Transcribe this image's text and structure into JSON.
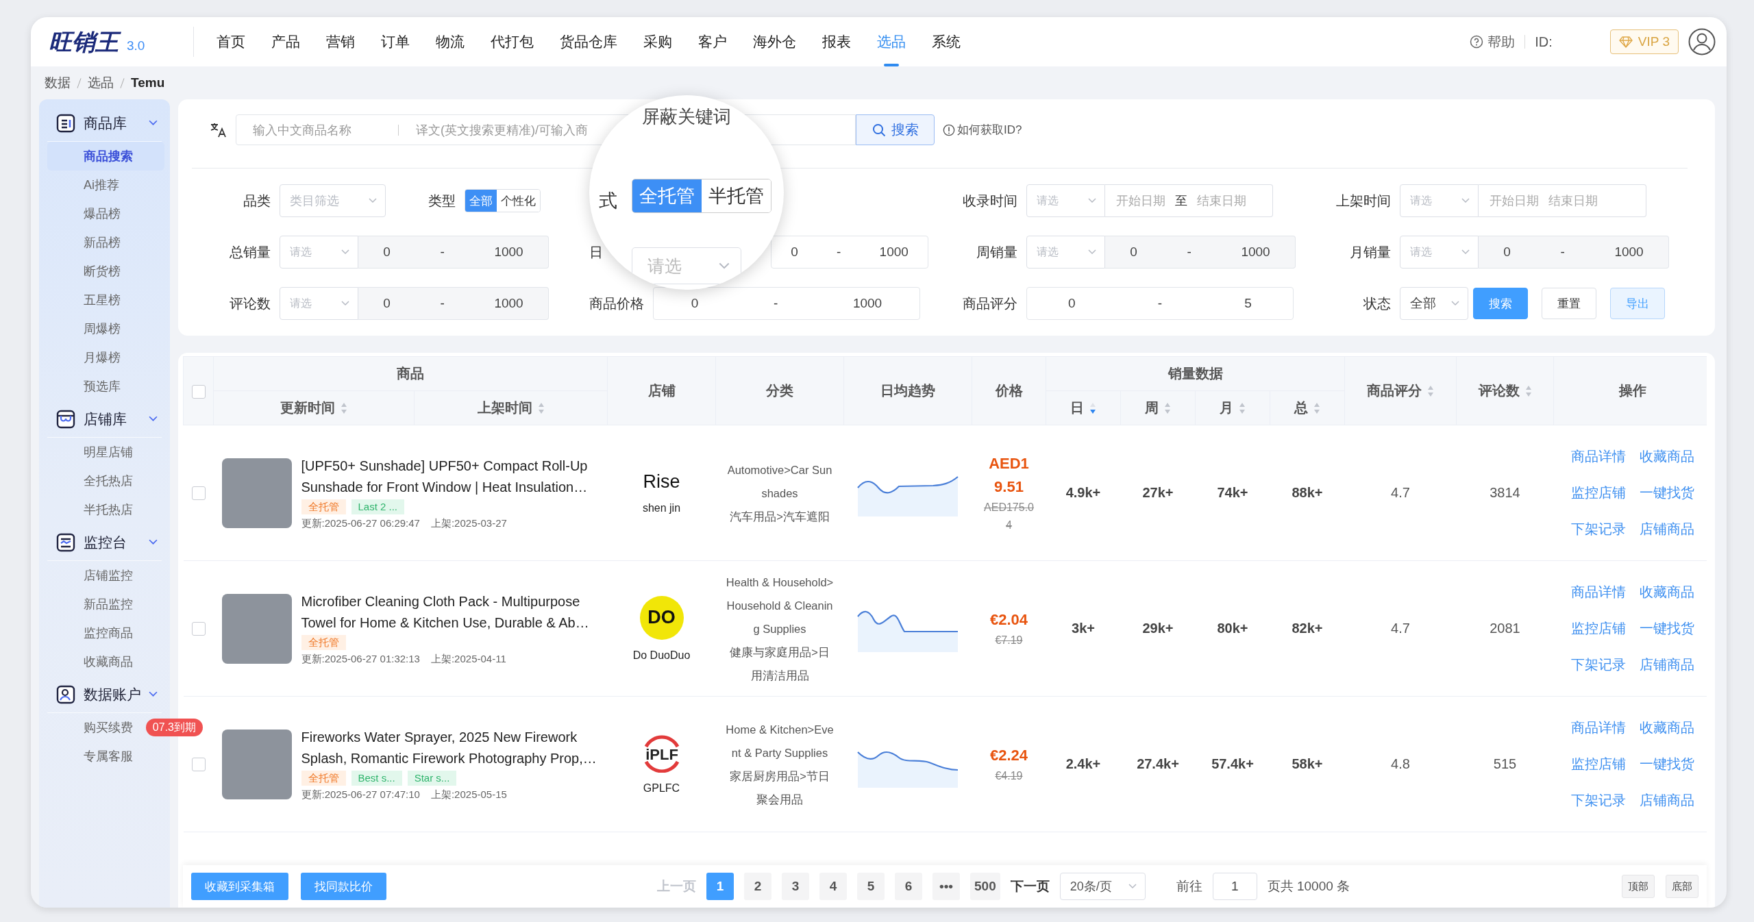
{
  "logo": {
    "name": "旺销王",
    "version": "3.0"
  },
  "nav": [
    {
      "label": "首页",
      "selected": false
    },
    {
      "label": "产品",
      "selected": false
    },
    {
      "label": "营销",
      "selected": false
    },
    {
      "label": "订单",
      "selected": false
    },
    {
      "label": "物流",
      "selected": false
    },
    {
      "label": "代打包",
      "selected": false
    },
    {
      "label": "货品仓库",
      "selected": false
    },
    {
      "label": "采购",
      "selected": false
    },
    {
      "label": "客户",
      "selected": false
    },
    {
      "label": "海外仓",
      "selected": false
    },
    {
      "label": "报表",
      "selected": false
    },
    {
      "label": "选品",
      "selected": true
    },
    {
      "label": "系统",
      "selected": false
    }
  ],
  "header_right": {
    "help": "帮助",
    "id_label": "ID:",
    "vip": "VIP 3"
  },
  "breadcrumb": [
    {
      "label": "数据",
      "current": false
    },
    {
      "label": "选品",
      "current": false
    },
    {
      "label": "Temu",
      "current": true
    }
  ],
  "sidebar": [
    {
      "title": "商品库",
      "expanded": true,
      "items": [
        {
          "label": "商品搜索",
          "selected": true
        },
        {
          "label": "Ai推荐",
          "selected": false
        },
        {
          "label": "爆品榜",
          "selected": false
        },
        {
          "label": "新品榜",
          "selected": false
        },
        {
          "label": "断货榜",
          "selected": false
        },
        {
          "label": "五星榜",
          "selected": false
        },
        {
          "label": "周爆榜",
          "selected": false
        },
        {
          "label": "月爆榜",
          "selected": false
        },
        {
          "label": "预选库",
          "selected": false
        }
      ]
    },
    {
      "title": "店铺库",
      "expanded": true,
      "items": [
        {
          "label": "明星店铺",
          "selected": false
        },
        {
          "label": "全托热店",
          "selected": false
        },
        {
          "label": "半托热店",
          "selected": false
        }
      ]
    },
    {
      "title": "监控台",
      "expanded": true,
      "items": [
        {
          "label": "店铺监控",
          "selected": false
        },
        {
          "label": "新品监控",
          "selected": false
        },
        {
          "label": "监控商品",
          "selected": false
        },
        {
          "label": "收藏商品",
          "selected": false
        }
      ]
    },
    {
      "title": "数据账户",
      "expanded": true,
      "items": [
        {
          "label": "购买续费",
          "selected": false,
          "badge": "07.3到期"
        },
        {
          "label": "专属客服",
          "selected": false
        }
      ]
    }
  ],
  "search": {
    "placeholder": "输入中文商品名称",
    "translation_placeholder": "译文(英文搜索更精准)/可输入商",
    "button": "搜索",
    "help_link": "如何获取ID?"
  },
  "filters": [
    [
      {
        "kind": "select",
        "label": "品类",
        "placeholder": "类目筛选"
      },
      {
        "kind": "toggle",
        "label": "类型",
        "options": [
          {
            "label": "全部",
            "selected": true
          },
          {
            "label": "个性化",
            "selected": false
          }
        ]
      },
      {
        "kind": "daterange",
        "label": "收录时间",
        "select": "请选",
        "start": "开始日期",
        "separator": "至",
        "end": "结束日期"
      },
      {
        "kind": "daterange",
        "label": "上架时间",
        "select": "请选",
        "start": "开始日期",
        "end": "结束日期"
      }
    ],
    [
      {
        "kind": "range",
        "label": "总销量",
        "select": "请选",
        "min": "0",
        "dash": "-",
        "max": "1000"
      },
      {
        "kind": "range",
        "label": "日",
        "min": "0",
        "dash": "-",
        "max": "1000"
      },
      {
        "kind": "range",
        "label": "周销量",
        "select": "请选",
        "min": "0",
        "dash": "-",
        "max": "1000"
      },
      {
        "kind": "range",
        "label": "月销量",
        "select": "请选",
        "min": "0",
        "dash": "-",
        "max": "1000"
      }
    ],
    [
      {
        "kind": "range",
        "label": "评论数",
        "select": "请选",
        "min": "0",
        "dash": "-",
        "max": "1000"
      },
      {
        "kind": "range",
        "label": "商品价格",
        "min": "0",
        "dash": "-",
        "max": "1000"
      },
      {
        "kind": "range",
        "label": "商品评分",
        "min": "0",
        "dash": "-",
        "max": "5"
      },
      {
        "kind": "status",
        "label": "状态",
        "value": "全部"
      },
      {
        "kind": "buttons",
        "buttons": [
          {
            "label": "搜索",
            "kind": "primary"
          },
          {
            "label": "重置",
            "kind": "default"
          },
          {
            "label": "导出",
            "kind": "light"
          }
        ]
      }
    ]
  ],
  "magnifier": {
    "caption": "屏蔽关键词",
    "label": "式",
    "options": [
      {
        "label": "全托管",
        "selected": true
      },
      {
        "label": "半托管",
        "selected": false
      }
    ],
    "select": "请选"
  },
  "table": {
    "select_all_checked": false,
    "product_group": "商品",
    "sales_group": "销量数据",
    "columns": [
      {
        "label": "更新时间",
        "sorted": false
      },
      {
        "label": "上架时间",
        "sorted": false
      },
      {
        "label": "店铺"
      },
      {
        "label": "分类"
      },
      {
        "label": "日均趋势"
      },
      {
        "label": "价格"
      },
      {
        "label": "日",
        "sorted": true
      },
      {
        "label": "周",
        "sorted": false
      },
      {
        "label": "月",
        "sorted": false
      },
      {
        "label": "总",
        "sorted": false
      },
      {
        "label": "商品评分",
        "sorted": false
      },
      {
        "label": "评论数",
        "sorted": false
      },
      {
        "label": "操作"
      }
    ],
    "rows": [
      {
        "checked": false,
        "title": "[UPF50+ Sunshade] UPF50+ Compact Roll-Up Sunshade for Front Window | Heat Insulation…",
        "tags": [
          {
            "label": "全托管",
            "kind": "mode"
          },
          {
            "label": "Last 2 ...",
            "kind": "tag"
          }
        ],
        "updated": "更新:2025-06-27 06:29:47",
        "listed": "上架:2025-03-27",
        "store": {
          "logo": "Rise",
          "kind": "wordmark",
          "name": "shen jin"
        },
        "category_en": "Automotive>Car Sunshades",
        "category_cn": "汽车用品>汽车遮阳",
        "trend": {
          "kind": "wave"
        },
        "price": "AED19.51",
        "original_price": "AED175.04",
        "day": "4.9k+",
        "week": "27k+",
        "month": "74k+",
        "total": "88k+",
        "rating": "4.7",
        "reviews": "3814",
        "actions": [
          "商品详情",
          "收藏商品",
          "监控店铺",
          "一键找货",
          "下架记录",
          "店铺商品"
        ]
      },
      {
        "checked": false,
        "title": "Microfiber Cleaning Cloth Pack - Multipurpose Towel for Home & Kitchen Use, Durable & Ab…",
        "tags": [
          {
            "label": "全托管",
            "kind": "mode"
          }
        ],
        "updated": "更新:2025-06-27 01:32:13",
        "listed": "上架:2025-04-11",
        "store": {
          "logo": "DO",
          "kind": "circle",
          "name": "Do DuoDuo"
        },
        "category_en": "Health & Household>Household & Cleaning Supplies",
        "category_cn": "健康与家庭用品>日用清洁用品",
        "trend": {
          "kind": "drop"
        },
        "price": "€2.04",
        "original_price": "€7.19",
        "day": "3k+",
        "week": "29k+",
        "month": "80k+",
        "total": "82k+",
        "rating": "4.7",
        "reviews": "2081",
        "actions": [
          "商品详情",
          "收藏商品",
          "监控店铺",
          "一键找货",
          "下架记录",
          "店铺商品"
        ]
      },
      {
        "checked": false,
        "title": "Fireworks Water Sprayer, 2025 New Firework Splash, Romantic Firework Photography Prop,…",
        "tags": [
          {
            "label": "全托管",
            "kind": "mode"
          },
          {
            "label": "Best s...",
            "kind": "tag"
          },
          {
            "label": "Star s...",
            "kind": "tag"
          }
        ],
        "updated": "更新:2025-06-27 07:47:10",
        "listed": "上架:2025-05-15",
        "store": {
          "logo": "iPLF",
          "kind": "emblem",
          "name": "GPLFC"
        },
        "category_en": "Home & Kitchen>Event & Party Supplies",
        "category_cn": "家居厨房用品>节日聚会用品",
        "trend": {
          "kind": "decline"
        },
        "price": "€2.24",
        "original_price": "€4.19",
        "day": "2.4k+",
        "week": "27.4k+",
        "month": "57.4k+",
        "total": "58k+",
        "rating": "4.8",
        "reviews": "515",
        "actions": [
          "商品详情",
          "收藏商品",
          "监控店铺",
          "一键找货",
          "下架记录",
          "店铺商品"
        ]
      }
    ]
  },
  "footer": {
    "buttons": [
      "收藏到采集箱",
      "找同款比价"
    ],
    "prev": {
      "label": "上一页",
      "disabled": true
    },
    "pages": [
      {
        "label": "1",
        "selected": true
      },
      {
        "label": "2",
        "selected": false
      },
      {
        "label": "3",
        "selected": false
      },
      {
        "label": "4",
        "selected": false
      },
      {
        "label": "5",
        "selected": false
      },
      {
        "label": "6",
        "selected": false
      },
      {
        "label": "•••",
        "selected": false
      },
      {
        "label": "500",
        "selected": false
      }
    ],
    "next": {
      "label": "下一页",
      "disabled": false
    },
    "page_size": "20条/页",
    "goto_label": "前往",
    "goto_value": "1",
    "total": "页共 10000 条",
    "scroll_buttons": [
      "顶部",
      "底部"
    ]
  }
}
